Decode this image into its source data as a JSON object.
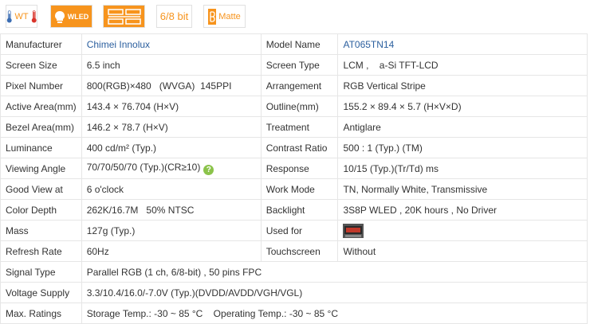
{
  "badges": [
    {
      "name": "wide-temperature-badge",
      "text": "WT"
    },
    {
      "name": "wled-badge",
      "text": "WLED"
    },
    {
      "name": "interface-badge",
      "text": ""
    },
    {
      "name": "color-depth-badge",
      "text": "6/8 bit"
    },
    {
      "name": "surface-badge",
      "text": "Matte"
    }
  ],
  "rows": [
    {
      "l1": "Manufacturer",
      "v1": "Chimei Innolux",
      "l2": "Model Name",
      "v2": "AT065TN14"
    },
    {
      "l1": "Screen Size",
      "v1": "6.5 inch",
      "l2": "Screen Type",
      "v2": "LCM ,    a-Si TFT-LCD"
    },
    {
      "l1": "Pixel Number",
      "v1": "800(RGB)×480   (WVGA)  145PPI",
      "l2": "Arrangement",
      "v2": "RGB Vertical Stripe"
    },
    {
      "l1": "Active Area(mm)",
      "v1": "143.4 × 76.704 (H×V)",
      "l2": "Outline(mm)",
      "v2": "155.2 × 89.4 × 5.7 (H×V×D)"
    },
    {
      "l1": "Bezel Area(mm)",
      "v1": "146.2 × 78.7 (H×V)",
      "l2": "Treatment",
      "v2": "Antiglare"
    },
    {
      "l1": "Luminance",
      "v1": "400 cd/m² (Typ.)",
      "l2": "Contrast Ratio",
      "v2": "500 : 1 (Typ.) (TM)"
    },
    {
      "l1": "Viewing Angle",
      "v1": "70/70/50/70 (Typ.)(CR≥10)",
      "l2": "Response",
      "v2": "10/15 (Typ.)(Tr/Td) ms"
    },
    {
      "l1": "Good View at",
      "v1": "6 o'clock",
      "l2": "Work Mode",
      "v2": "TN, Normally White, Transmissive"
    },
    {
      "l1": "Color Depth",
      "v1": "262K/16.7M   50% NTSC",
      "l2": "Backlight",
      "v2": "3S8P WLED , 20K hours , No Driver"
    },
    {
      "l1": "Mass",
      "v1": "127g (Typ.)",
      "l2": "Used for",
      "v2": ""
    },
    {
      "l1": "Refresh Rate",
      "v1": "60Hz",
      "l2": "Touchscreen",
      "v2": "Without"
    }
  ],
  "wide_rows": [
    {
      "label": "Signal Type",
      "value": "Parallel RGB (1 ch, 6/8-bit) , 50 pins FPC"
    },
    {
      "label": "Voltage Supply",
      "value": "3.3/10.4/16.0/-7.0V (Typ.)(DVDD/AVDD/VGH/VGL)"
    },
    {
      "label": "Max. Ratings",
      "value": "Storage Temp.: -30 ~ 85 °C    Operating Temp.: -30 ~ 85 °C"
    }
  ],
  "help_icon_text": "?",
  "colors": {
    "accent": "#f7941d",
    "link": "#2b5f9e",
    "help": "#8bc34a"
  }
}
